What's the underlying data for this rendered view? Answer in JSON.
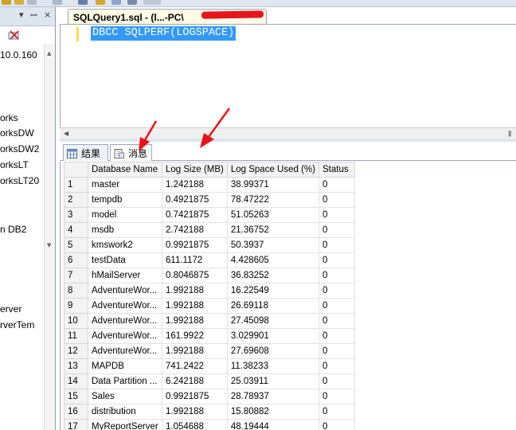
{
  "explorer": {
    "header_buttons": [
      "▾",
      "ꟷ",
      "×"
    ],
    "server_label": "10.0.160",
    "tree_items": [
      "orks",
      "orksDW",
      "orksDW2",
      "orksLT",
      "orksLT20",
      "n DB2",
      "erver",
      "rverTem"
    ]
  },
  "editor": {
    "tab_title": "SQLQuery1.sql - (l...-PC\\",
    "code": "DBCC SQLPERF(LOGSPACE)"
  },
  "result_tabs": {
    "results_label": "结果",
    "messages_label": "消息"
  },
  "grid": {
    "columns": [
      "",
      "Database Name",
      "Log Size (MB)",
      "Log Space Used (%)",
      "Status"
    ],
    "rows": [
      [
        "1",
        "master",
        "1.242188",
        "38.99371",
        "0"
      ],
      [
        "2",
        "tempdb",
        "0.4921875",
        "78.47222",
        "0"
      ],
      [
        "3",
        "model",
        "0.7421875",
        "51.05263",
        "0"
      ],
      [
        "4",
        "msdb",
        "2.742188",
        "21.36752",
        "0"
      ],
      [
        "5",
        "kmswork2",
        "0.9921875",
        "50.3937",
        "0"
      ],
      [
        "6",
        "testData",
        "611.1172",
        "4.428605",
        "0"
      ],
      [
        "7",
        "hMailServer",
        "0.8046875",
        "36.83252",
        "0"
      ],
      [
        "8",
        "AdventureWor...",
        "1.992188",
        "16.22549",
        "0"
      ],
      [
        "9",
        "AdventureWor...",
        "1.992188",
        "26.69118",
        "0"
      ],
      [
        "10",
        "AdventureWor...",
        "1.992188",
        "27.45098",
        "0"
      ],
      [
        "11",
        "AdventureWor...",
        "161.9922",
        "3.029901",
        "0"
      ],
      [
        "12",
        "AdventureWor...",
        "1.992188",
        "27.69608",
        "0"
      ],
      [
        "13",
        "MAPDB",
        "741.2422",
        "11.38233",
        "0"
      ],
      [
        "14",
        "Data Partition ...",
        "6.242188",
        "25.03911",
        "0"
      ],
      [
        "15",
        "Sales",
        "0.9921875",
        "28.78937",
        "0"
      ],
      [
        "16",
        "distribution",
        "1.992188",
        "15.80882",
        "0"
      ],
      [
        "17",
        "MyReportServer",
        "1.054688",
        "48.19444",
        "0"
      ]
    ]
  },
  "colors": {
    "selection": "#3399ff",
    "annotation_arrow": "#e8141b",
    "redaction": "#e8141b"
  }
}
